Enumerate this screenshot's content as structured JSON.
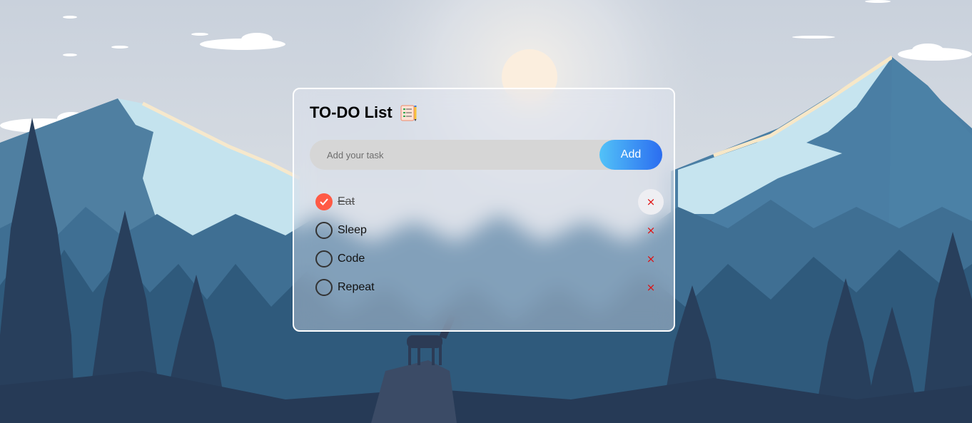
{
  "app": {
    "title": "TO-DO List",
    "title_icon": "checklist-notepad-icon"
  },
  "input": {
    "placeholder": "Add your task",
    "value": ""
  },
  "add_button": {
    "label": "Add"
  },
  "tasks": [
    {
      "label": "Eat",
      "completed": true,
      "delete_label": "×",
      "hovered": true
    },
    {
      "label": "Sleep",
      "completed": false,
      "delete_label": "×"
    },
    {
      "label": "Code",
      "completed": false,
      "delete_label": "×"
    },
    {
      "label": "Repeat",
      "completed": false,
      "delete_label": "×"
    }
  ],
  "colors": {
    "accent_gradient_start": "#52c2f8",
    "accent_gradient_end": "#2b6df0",
    "checked": "#ff5a45",
    "delete": "#e01010",
    "card_border": "#ffffff"
  },
  "background": {
    "description_icon": "mountain-forest-deer-scene"
  }
}
